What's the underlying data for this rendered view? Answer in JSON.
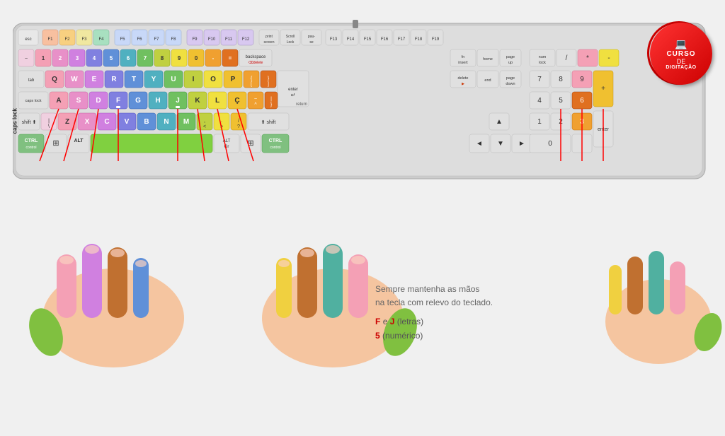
{
  "badge": {
    "line1": "CURSO",
    "line2": "DE",
    "line3": "DIGITAÇÃO"
  },
  "caps_lock_label": "caps lock",
  "text_block": {
    "line1": "Sempre mantenha as mãos",
    "line2": "na tecla com relevo do teclado.",
    "line3": "F e J (letras)",
    "line4": "5 (numérico)"
  },
  "colors": {
    "pink": "#f4a0b5",
    "purple": "#b070d0",
    "blue": "#6090d0",
    "teal": "#60b0a0",
    "green": "#90c050",
    "lime": "#c0e040",
    "yellow": "#f0e050",
    "orange": "#f0a030",
    "dark_orange": "#e06010",
    "gray": "#c0c0c0",
    "ctrl_green": "#70c070",
    "white_key": "#f0f0f0",
    "red": "#cc0000"
  }
}
